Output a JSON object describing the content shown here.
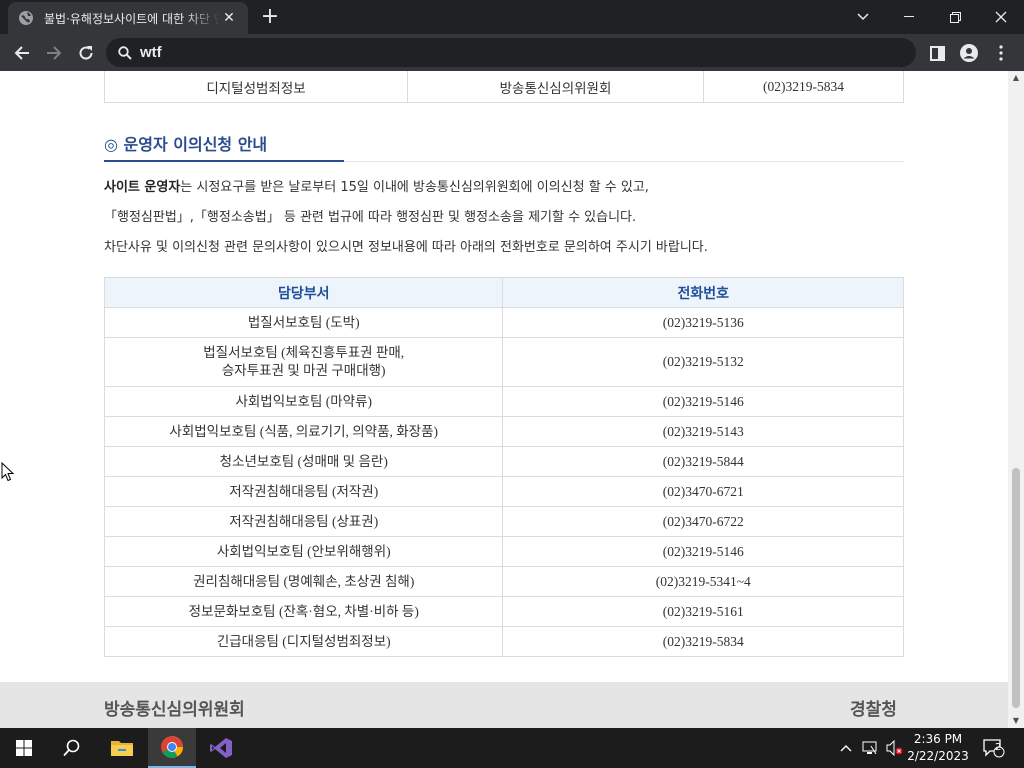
{
  "browser": {
    "tab_title": "불법·유해정보사이트에 대한 차단 안내",
    "tab_close": "✕",
    "new_tab": "+",
    "address": "wtf"
  },
  "page": {
    "top_row": [
      "디지털성범죄정보",
      "방송통신심의위원회",
      "(02)3219-5834"
    ],
    "section_title": "◎ 운영자 이의신청 안내",
    "para1_bold": "사이트 운영자",
    "para1_rest": "는 시정요구를 받은 날로부터 15일 이내에 방송통신심의위원회에 이의신청 할 수 있고,",
    "para2": "「행정심판법」,「행정소송법」 등 관련 법규에 따라 행정심판 및 행정소송을 제기할 수 있습니다.",
    "para3": "차단사유 및 이의신청 관련 문의사항이 있으시면 정보내용에 따라 아래의 전화번호로 문의하여 주시기 바랍니다.",
    "table": {
      "headers": [
        "담당부서",
        "전화번호"
      ],
      "rows": [
        {
          "dept": "법질서보호팀 (도박)",
          "phone": "(02)3219-5136"
        },
        {
          "dept": "법질서보호팀 (체육진흥투표권 판매,",
          "dept2": "승자투표권 및 마권 구매대행)",
          "phone": "(02)3219-5132"
        },
        {
          "dept": "사회법익보호팀 (마약류)",
          "phone": "(02)3219-5146"
        },
        {
          "dept": "사회법익보호팀 (식품, 의료기기, 의약품, 화장품)",
          "phone": "(02)3219-5143"
        },
        {
          "dept": "청소년보호팀 (성매매 및 음란)",
          "phone": "(02)3219-5844"
        },
        {
          "dept": "저작권침해대응팀 (저작권)",
          "phone": "(02)3470-6721"
        },
        {
          "dept": "저작권침해대응팀 (상표권)",
          "phone": "(02)3470-6722"
        },
        {
          "dept": "사회법익보호팀 (안보위해행위)",
          "phone": "(02)3219-5146"
        },
        {
          "dept": "권리침해대응팀 (명예훼손, 초상권 침해)",
          "phone": "(02)3219-5341~4"
        },
        {
          "dept": "정보문화보호팀 (잔혹·혐오, 차별·비하 등)",
          "phone": "(02)3219-5161"
        },
        {
          "dept": "긴급대응팀 (디지털성범죄정보)",
          "phone": "(02)3219-5834"
        }
      ]
    },
    "footer_left": "방송통신심의위원회",
    "footer_right": "경찰청"
  },
  "taskbar": {
    "time": "2:36 PM",
    "date": "2/22/2023",
    "notification_count": "2"
  },
  "colors": {
    "accent": "#2b4d8f",
    "table_header_bg": "#eef4fb",
    "table_header_text": "#1f4f9b",
    "footer_bg": "#e5e5e5"
  }
}
